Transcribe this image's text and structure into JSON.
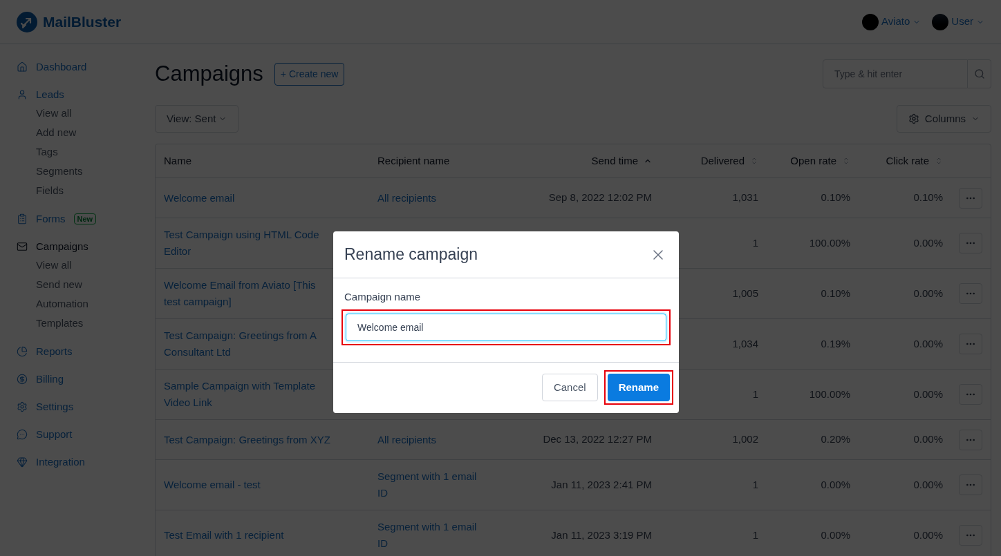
{
  "header": {
    "logo": "MailBluster",
    "account_menu": "Aviato",
    "user_menu": "User"
  },
  "sidebar": {
    "items": [
      {
        "label": "Dashboard",
        "selected": false
      },
      {
        "label": "Leads",
        "selected": false,
        "children": [
          "View all",
          "Add new",
          "Tags",
          "Segments",
          "Fields"
        ]
      },
      {
        "label": "Forms",
        "selected": false,
        "badge": "New"
      },
      {
        "label": "Campaigns",
        "selected": true,
        "children": [
          "View all",
          "Send new",
          "Automation",
          "Templates"
        ]
      },
      {
        "label": "Reports",
        "selected": false
      },
      {
        "label": "Billing",
        "selected": false
      },
      {
        "label": "Settings",
        "selected": false
      },
      {
        "label": "Support",
        "selected": false
      },
      {
        "label": "Integration",
        "selected": false
      }
    ]
  },
  "page": {
    "title": "Campaigns",
    "create_button": "+ Create new",
    "search": {
      "placeholder": "Type & hit enter"
    },
    "view_menu": "View: Sent",
    "columns_menu": "Columns"
  },
  "table": {
    "columns": [
      {
        "label": "Name"
      },
      {
        "label": "Recipient name"
      },
      {
        "label": "Send time",
        "sorted": true
      },
      {
        "label": "Delivered",
        "sorted": false
      },
      {
        "label": "Open rate",
        "sorted": false
      },
      {
        "label": "Click rate",
        "sorted": false
      }
    ],
    "rows": [
      {
        "name_lines": [
          "Welcome email"
        ],
        "recipient_lines": [
          "All recipients"
        ],
        "send_time": "Sep 8, 2022 12:02 PM",
        "delivered": "1,031",
        "open_rate": "0.10%",
        "click_rate": "0.10%"
      },
      {
        "name_lines": [
          "Test Campaign using HTML Code",
          "Editor"
        ],
        "delivered": "1",
        "open_rate": "100.00%",
        "click_rate": "0.00%"
      },
      {
        "name_lines": [
          "Welcome Email from Aviato [This",
          "test campaign]"
        ],
        "delivered": "1,005",
        "open_rate": "0.10%",
        "click_rate": "0.00%"
      },
      {
        "name_lines": [
          "Test Campaign: Greetings from A",
          "Consultant Ltd"
        ],
        "delivered": "1,034",
        "open_rate": "0.19%",
        "click_rate": "0.00%"
      },
      {
        "name_lines": [
          "Sample Campaign with Template",
          "Video Link"
        ],
        "delivered": "1",
        "open_rate": "100.00%",
        "click_rate": "0.00%"
      },
      {
        "name_lines": [
          "Test Campaign: Greetings from XYZ"
        ],
        "recipient_lines": [
          "All recipients"
        ],
        "send_time": "Dec 13, 2022 12:27 PM",
        "delivered": "1,002",
        "open_rate": "0.20%",
        "click_rate": "0.00%"
      },
      {
        "name_lines": [
          "Welcome email - test"
        ],
        "recipient_lines": [
          "Segment with 1 email",
          "ID"
        ],
        "send_time": "Jan 11, 2023 2:41 PM",
        "delivered": "1",
        "open_rate": "0.00%",
        "click_rate": "0.00%"
      },
      {
        "name_lines": [
          "Test Email with 1 recipient"
        ],
        "recipient_lines": [
          "Segment with 1 email",
          "ID"
        ],
        "send_time": "Jan 11, 2023 3:19 PM",
        "delivered": "1",
        "open_rate": "0.00%",
        "click_rate": "0.00%"
      }
    ]
  },
  "modal": {
    "title": "Rename campaign",
    "field": {
      "label": "Campaign name",
      "value": "Welcome email",
      "highlighted": true
    },
    "buttons": [
      {
        "label": "Cancel",
        "kind": "secondary"
      },
      {
        "label": "Rename",
        "kind": "primary",
        "highlighted": true
      }
    ]
  }
}
